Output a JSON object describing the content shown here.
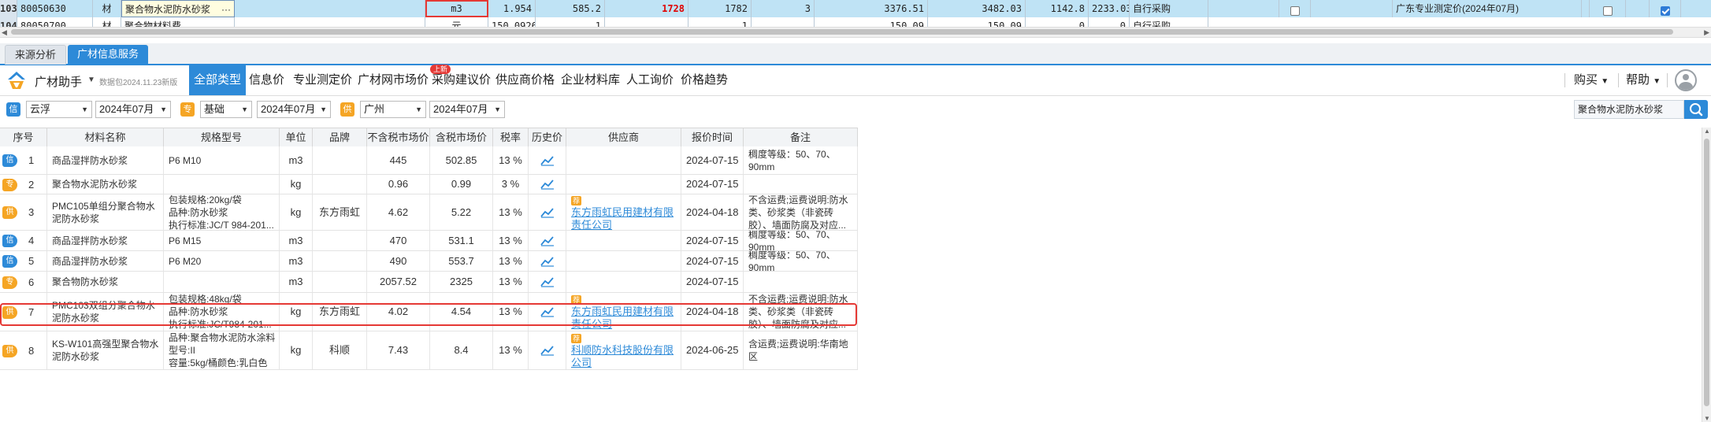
{
  "sheet": {
    "row1": {
      "rownum": "103",
      "code": "80050630",
      "type": "材",
      "name": "聚合物水泥防水砂浆",
      "name_more": "···",
      "unit": "m3",
      "qty": "1.954",
      "v1": "585.2",
      "v2": "1728",
      "v3": "1782",
      "v4": "3",
      "v5": "3376.51",
      "v6": "3482.03",
      "v7": "1142.8",
      "v8": "2233.03",
      "src": "自行采购",
      "note": "广东专业测定价(2024年07月)"
    },
    "row2": {
      "rownum": "104",
      "code": "80050700",
      "type": "材",
      "name": "聚合物材料费",
      "unit": "元",
      "qty": "150.0926",
      "v1": "1",
      "v3": "1",
      "v5": "150.09",
      "v6": "150.09",
      "v7": "0",
      "v8": "0",
      "src": "自行采购"
    }
  },
  "tabs": [
    "来源分析",
    "广材信息服务"
  ],
  "nav": {
    "brand": "广材助手",
    "data_note": "数据包2024.11.23新版",
    "items": [
      "全部类型",
      "信息价",
      "专业测定价",
      "广材网市场价",
      "采购建议价",
      "供应商价格",
      "企业材料库",
      "人工询价",
      "价格趋势"
    ],
    "new_badge": "上新",
    "buy": "购买",
    "help": "帮助"
  },
  "filters": {
    "tag_xin": "信",
    "region1": "云浮",
    "period1": "2024年07月",
    "tag_zhuan": "专",
    "category": "基础",
    "period2": "2024年07月",
    "tag_gong": "供",
    "region2": "广州",
    "period3": "2024年07月",
    "search_value": "聚合物水泥防水砂浆"
  },
  "table": {
    "headers": [
      "序号",
      "材料名称",
      "规格型号",
      "单位",
      "品牌",
      "不含税市场价",
      "含税市场价",
      "税率",
      "历史价",
      "供应商",
      "报价时间",
      "备注"
    ],
    "rows": [
      {
        "tag": "信",
        "tagc": "blue",
        "no": "1",
        "name": "商品湿拌防水砂浆",
        "spec": "P6 M10",
        "unit": "m3",
        "brand": "",
        "p1": "445",
        "p2": "502.85",
        "tax": "13 %",
        "supplier": "",
        "rec": "",
        "date": "2024-07-15",
        "note": "稠度等级：50、70、90mm"
      },
      {
        "tag": "专",
        "tagc": "orange",
        "no": "2",
        "name": "聚合物水泥防水砂浆",
        "spec": "",
        "unit": "kg",
        "brand": "",
        "p1": "0.96",
        "p2": "0.99",
        "tax": "3 %",
        "supplier": "",
        "rec": "",
        "date": "2024-07-15",
        "note": ""
      },
      {
        "tag": "供",
        "tagc": "orange",
        "no": "3",
        "name": "PMC105单组分聚合物水泥防水砂浆",
        "spec": "包装规格:20kg/袋\n品种:防水砂浆\n执行标准:JC/T 984-201...",
        "unit": "kg",
        "brand": "东方雨虹",
        "p1": "4.62",
        "p2": "5.22",
        "tax": "13 %",
        "supplier": "东方雨虹民用建材有限责任公司",
        "rec": "荐",
        "date": "2024-04-18",
        "note": "不含运费;运费说明:防水类、砂浆类（非瓷砖胶）、墙面防腐及对应..."
      },
      {
        "tag": "信",
        "tagc": "blue",
        "no": "4",
        "name": "商品湿拌防水砂浆",
        "spec": "P6 M15",
        "unit": "m3",
        "brand": "",
        "p1": "470",
        "p2": "531.1",
        "tax": "13 %",
        "supplier": "",
        "rec": "",
        "date": "2024-07-15",
        "note": "稠度等级：50、70、90mm"
      },
      {
        "tag": "信",
        "tagc": "blue",
        "no": "5",
        "name": "商品湿拌防水砂浆",
        "spec": "P6 M20",
        "unit": "m3",
        "brand": "",
        "p1": "490",
        "p2": "553.7",
        "tax": "13 %",
        "supplier": "",
        "rec": "",
        "date": "2024-07-15",
        "note": "稠度等级：50、70、90mm"
      },
      {
        "tag": "专",
        "tagc": "orange",
        "no": "6",
        "name": "聚合物防水砂浆",
        "spec": "",
        "unit": "m3",
        "brand": "",
        "p1": "2057.52",
        "p2": "2325",
        "tax": "13 %",
        "supplier": "",
        "rec": "",
        "date": "2024-07-15",
        "note": ""
      },
      {
        "tag": "供",
        "tagc": "orange",
        "no": "7",
        "name": "PMC103双组分聚合物水泥防水砂浆",
        "spec": "包装规格:48kg/袋\n品种:防水砂浆\n执行标准:JC/T984-201...",
        "unit": "kg",
        "brand": "东方雨虹",
        "p1": "4.02",
        "p2": "4.54",
        "tax": "13 %",
        "supplier": "东方雨虹民用建材有限责任公司",
        "rec": "荐",
        "date": "2024-04-18",
        "note": "不含运费;运费说明:防水类、砂浆类（非瓷砖胶）、墙面防腐及对应..."
      },
      {
        "tag": "供",
        "tagc": "orange",
        "no": "8",
        "name": "KS-W101高强型聚合物水泥防水砂浆",
        "spec": "品种:聚合物水泥防水涂料\n型号:II\n容量:5kg/桶颜色:乳白色",
        "unit": "kg",
        "brand": "科顺",
        "p1": "7.43",
        "p2": "8.4",
        "tax": "13 %",
        "supplier": "科顺防水科技股份有限公司",
        "rec": "荐",
        "date": "2024-06-25",
        "note": "含运费;运费说明:华南地区"
      }
    ]
  }
}
